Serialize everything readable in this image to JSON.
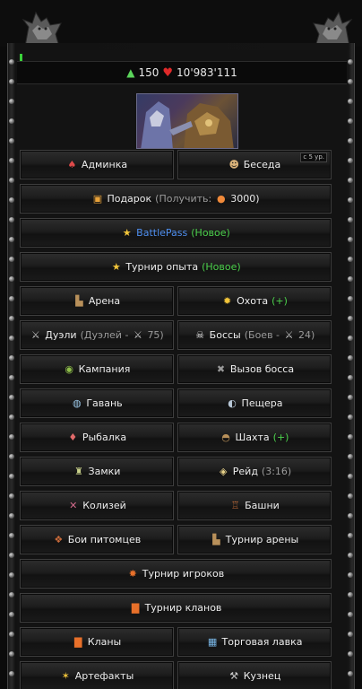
{
  "header": {
    "level": "150",
    "health": "10'983'111"
  },
  "menu": {
    "adminka": "Админка",
    "beseda": "Беседа",
    "beseda_badge": "с 5 ур.",
    "gift": "Подарок",
    "gift_receive": "(Получить:",
    "gift_amount": "3000)",
    "battlepass": "BattlePass",
    "battlepass_new": "(Новое)",
    "exp_tournament": "Турнир опыта",
    "exp_tournament_new": "(Новое)",
    "arena": "Арена",
    "hunt": "Охота",
    "hunt_plus": "(+)",
    "duels": "Дуэли",
    "duels_count": "(Дуэлей -",
    "duels_num": "75)",
    "bosses": "Боссы",
    "bosses_count": "(Боев -",
    "bosses_num": "24)",
    "campaign": "Кампания",
    "boss_call": "Вызов босса",
    "harbor": "Гавань",
    "cave": "Пещера",
    "fishing": "Рыбалка",
    "mine": "Шахта",
    "mine_plus": "(+)",
    "castles": "Замки",
    "raid": "Рейд",
    "raid_time": "(3:16)",
    "colosseum": "Колизей",
    "towers": "Башни",
    "pet_battles": "Бои питомцев",
    "arena_tournament": "Турнир арены",
    "player_tournament": "Турнир игроков",
    "clan_tournament": "Турнир кланов",
    "clans": "Кланы",
    "shop": "Торговая лавка",
    "artifacts": "Артефакты",
    "smith": "Кузнец"
  },
  "colors": {
    "green": "#4cd14c",
    "blue": "#4f8ff0",
    "orange": "#f08a3a",
    "heart": "#e02a2a"
  },
  "icons": [
    "level-up-arrow-icon",
    "heart-icon",
    "jester-icon",
    "user-icon",
    "gift-icon",
    "coin-icon",
    "star-icon",
    "arena-icon",
    "sun-icon",
    "crossed-swords-icon",
    "skull-icon",
    "campaign-icon",
    "boss-call-icon",
    "harbor-icon",
    "cave-icon",
    "fishing-icon",
    "mine-icon",
    "castle-icon",
    "raid-icon",
    "colosseum-icon",
    "tower-icon",
    "pet-battle-icon",
    "arena-tournament-icon",
    "player-tournament-icon",
    "clan-tournament-icon",
    "clan-icon",
    "shop-icon",
    "artifact-icon",
    "smith-icon"
  ]
}
